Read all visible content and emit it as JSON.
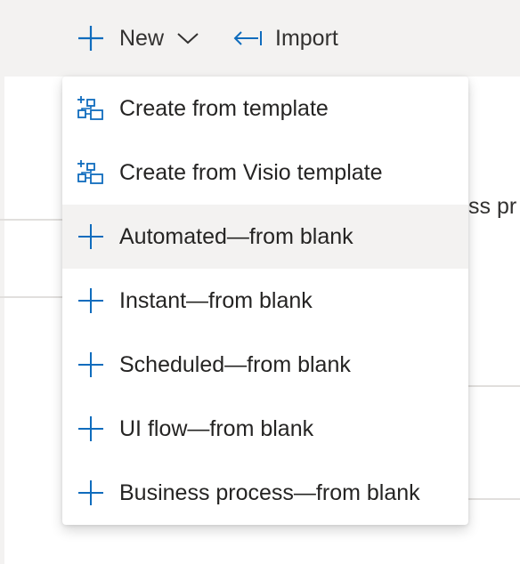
{
  "toolbar": {
    "new_label": "New",
    "import_label": "Import",
    "new_icon": "plus-icon",
    "dropdown_icon": "chevron-down-icon",
    "import_icon": "import-arrow-icon"
  },
  "background": {
    "partial_text": "ss pr"
  },
  "menu": {
    "items": [
      {
        "label": "Create from template",
        "icon": "template-icon"
      },
      {
        "label": "Create from Visio template",
        "icon": "visio-template-icon"
      },
      {
        "label": "Automated—from blank",
        "icon": "plus-icon",
        "hovered": true
      },
      {
        "label": "Instant—from blank",
        "icon": "plus-icon"
      },
      {
        "label": "Scheduled—from blank",
        "icon": "plus-icon"
      },
      {
        "label": "UI flow—from blank",
        "icon": "plus-icon"
      },
      {
        "label": "Business process—from blank",
        "icon": "plus-icon"
      }
    ]
  },
  "colors": {
    "accent": "#0f6cbd",
    "text": "#252423",
    "hover_bg": "#f3f2f1",
    "toolbar_bg": "#f3f2f1"
  }
}
